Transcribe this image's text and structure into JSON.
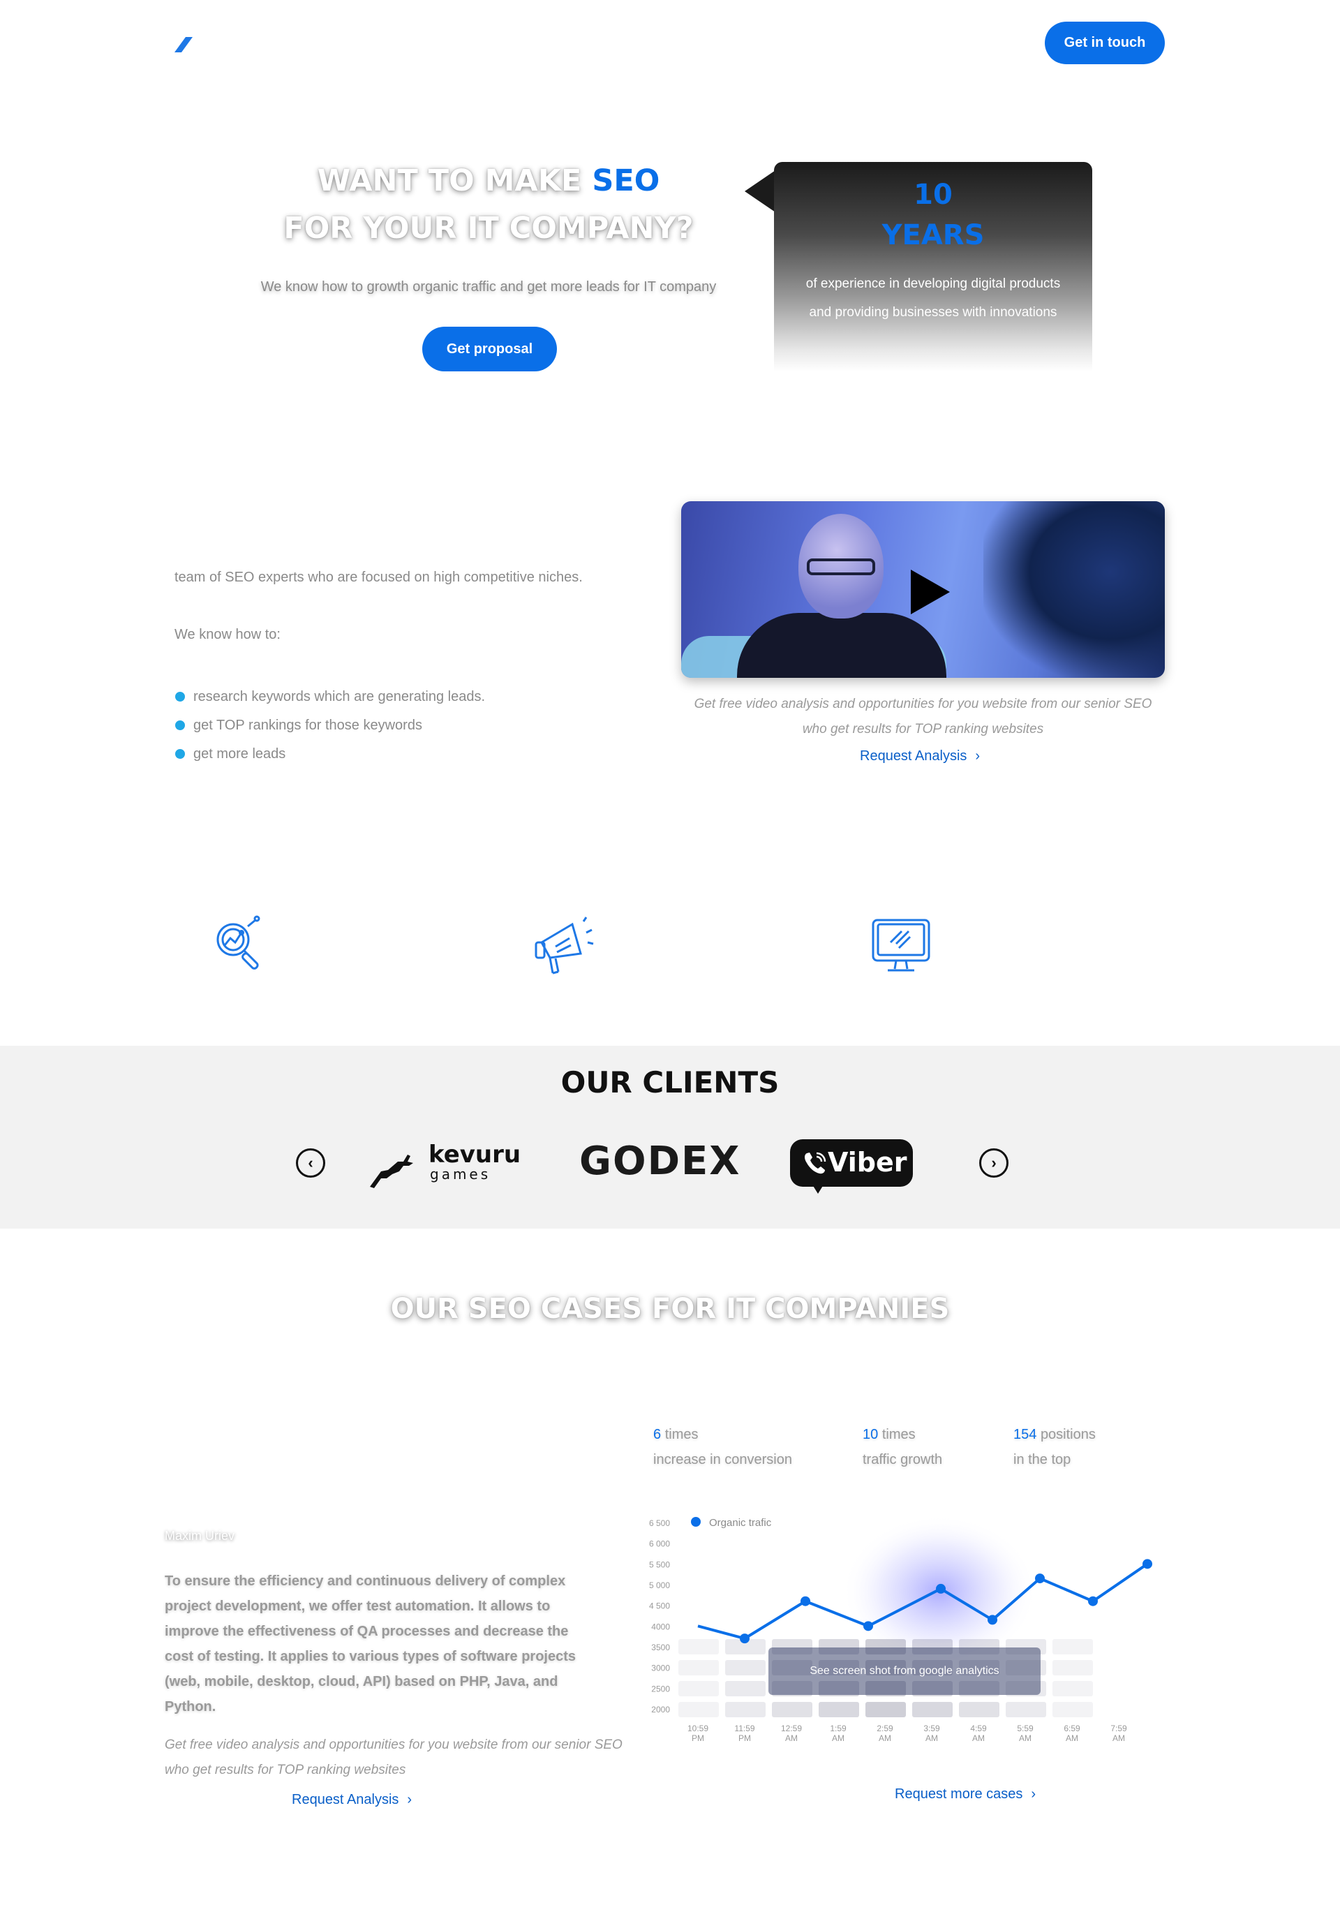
{
  "header": {
    "cta_label": "Get in touch"
  },
  "hero": {
    "title_line1_prefix": "WANT TO MAKE ",
    "title_line1_highlight": "SEO",
    "title_line2": "FOR YOUR IT COMPANY?",
    "subtitle": "We know how to growth organic traffic and get more leads for IT company",
    "cta_label": "Get proposal",
    "experience": {
      "number": "10",
      "unit": "YEARS",
      "text": "of experience in developing digital products and providing businesses with innovations"
    }
  },
  "about": {
    "intro": "team of SEO experts who are focused on high competitive niches.",
    "lead": "We know how to:",
    "bullets": [
      "research keywords which are generating leads.",
      "get TOP rankings for those keywords",
      "get more leads"
    ],
    "video_caption": "Get free video analysis and opportunities for  you website from our senior SEO who get results for TOP ranking websites",
    "video_link": "Request Analysis"
  },
  "services": {
    "icons": [
      "search-analytics-icon",
      "megaphone-icon",
      "monitor-icon"
    ]
  },
  "clients": {
    "title": "OUR CLIENTS",
    "logos": {
      "kevuru_word": "kevuru",
      "kevuru_sub": "games",
      "godex": "GODEX",
      "viber": "Viber"
    }
  },
  "cases": {
    "title": "OUR SEO CASES FOR IT COMPANIES",
    "stats": [
      {
        "number": "6",
        "unit": "times",
        "label": "increase in conversion"
      },
      {
        "number": "10",
        "unit": "times",
        "label": "traffic growth"
      },
      {
        "number": "154",
        "unit": "positions",
        "label": "in the top"
      }
    ],
    "author": "Maxim Uriev",
    "text": "To ensure the efficiency and continuous delivery of complex project development, we offer test automation. It allows to improve the effectiveness of QA processes and decrease the cost of testing. It applies to various types of software projects (web, mobile, desktop, cloud, API) based on PHP, Java, and Python.",
    "caption": "Get free video analysis and opportunities for  you website from our senior SEO who get results for TOP ranking websites",
    "analysis_link": "Request Analysis",
    "more_link": "Request more cases",
    "overlay_label": "See screen shot from google analytics"
  },
  "colors": {
    "accent": "#0a6fe8",
    "bullet": "#1fa7e6",
    "clients_bg": "#f2f2f2"
  },
  "chart_data": {
    "type": "line",
    "series": [
      {
        "name": "Organic trafic",
        "values": [
          4000,
          3700,
          4600,
          4000,
          4900,
          4150,
          5150,
          4600,
          5500
        ]
      }
    ],
    "x_tick_labels": [
      [
        "10:59",
        "PM"
      ],
      [
        "11:59",
        "PM"
      ],
      [
        "12:59",
        "AM"
      ],
      [
        "1:59",
        "AM"
      ],
      [
        "2:59",
        "AM"
      ],
      [
        "3:59",
        "AM"
      ],
      [
        "4:59",
        "AM"
      ],
      [
        "5:59",
        "AM"
      ],
      [
        "6:59",
        "AM"
      ],
      [
        "7:59",
        "AM"
      ]
    ],
    "y_ticks": [
      "6 500",
      "6 000",
      "5 500",
      "5 000",
      "4 500",
      "4000",
      "3500",
      "3000",
      "2500",
      "2000"
    ],
    "ylim": [
      2000,
      6500
    ],
    "legend_position": "top-left",
    "line_color": "#0a6fe8"
  }
}
